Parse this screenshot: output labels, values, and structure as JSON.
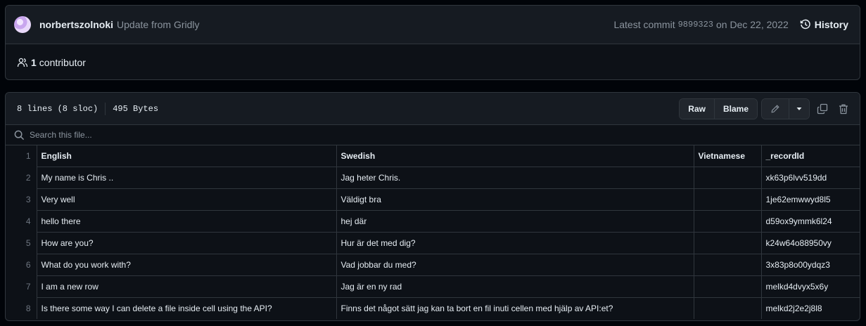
{
  "commit": {
    "author": "norbertszolnoki",
    "message": "Update from Gridly",
    "latest_label": "Latest commit",
    "sha": "9899323",
    "date": "on Dec 22, 2022",
    "history_label": "History"
  },
  "contributors": {
    "count": "1",
    "label": "contributor"
  },
  "file": {
    "lines": "8 lines (8 sloc)",
    "size": "495 Bytes",
    "raw_label": "Raw",
    "blame_label": "Blame"
  },
  "search": {
    "placeholder": "Search this file..."
  },
  "table": {
    "rows": [
      {
        "ln": "1",
        "cells": [
          "English",
          "Swedish",
          "Vietnamese",
          "_recordId"
        ]
      },
      {
        "ln": "2",
        "cells": [
          "My name is Chris ..",
          "Jag heter Chris.",
          "",
          "xk63p6lvv519dd"
        ]
      },
      {
        "ln": "3",
        "cells": [
          "Very well",
          "Väldigt bra",
          "",
          "1je62emwwyd8l5"
        ]
      },
      {
        "ln": "4",
        "cells": [
          "hello there",
          "hej där",
          "",
          "d59ox9ymmk6l24"
        ]
      },
      {
        "ln": "5",
        "cells": [
          "How are you?",
          "Hur är det med dig?",
          "",
          "k24w64o88950vy"
        ]
      },
      {
        "ln": "6",
        "cells": [
          "What do you work with?",
          "Vad jobbar du med?",
          "",
          "3x83p8o00ydqz3"
        ]
      },
      {
        "ln": "7",
        "cells": [
          "I am a new row",
          "Jag är en ny rad",
          "",
          "melkd4dvyx5x6y"
        ]
      },
      {
        "ln": "8",
        "cells": [
          "Is there some way I can delete a file inside cell using the API?",
          "Finns det något sätt jag kan ta bort en fil inuti cellen med hjälp av API:et?",
          "",
          "melkd2j2e2j8l8"
        ]
      }
    ]
  }
}
